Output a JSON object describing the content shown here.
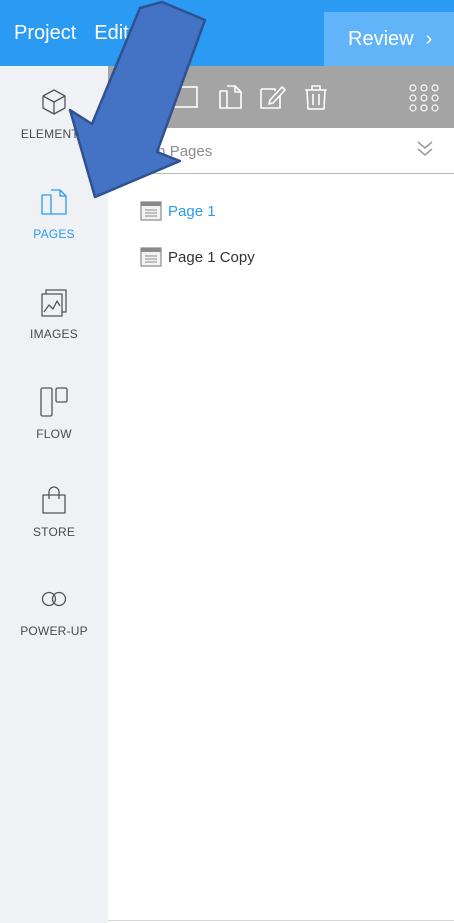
{
  "topbar": {
    "project_label": "Project",
    "edit_label": "Edit",
    "review_label": "Review",
    "review_chevron": "›"
  },
  "sidebar": {
    "items": [
      {
        "label": "ELEMENTS",
        "icon": "cube-icon"
      },
      {
        "label": "PAGES",
        "icon": "pages-icon",
        "active": true
      },
      {
        "label": "IMAGES",
        "icon": "image-icon"
      },
      {
        "label": "FLOW",
        "icon": "flow-icon"
      },
      {
        "label": "STORE",
        "icon": "shopping-bag-icon"
      },
      {
        "label": "POWER-UP",
        "icon": "infinity-icon"
      }
    ]
  },
  "toolbar": {
    "icons": [
      "new-page-icon",
      "duplicate-page-icon",
      "edit-page-icon",
      "delete-icon",
      "grid-icon"
    ]
  },
  "search": {
    "placeholder": "Search Pages"
  },
  "pages": [
    {
      "label": "Page 1",
      "active": true
    },
    {
      "label": "Page 1 Copy",
      "active": false
    }
  ],
  "colors": {
    "accent": "#2b9af3",
    "review_bg": "#61b4f7",
    "toolbar_bg": "#a4a4a4",
    "sidebar_bg": "#eff1f5",
    "annotation_arrow": "#4472c4"
  }
}
